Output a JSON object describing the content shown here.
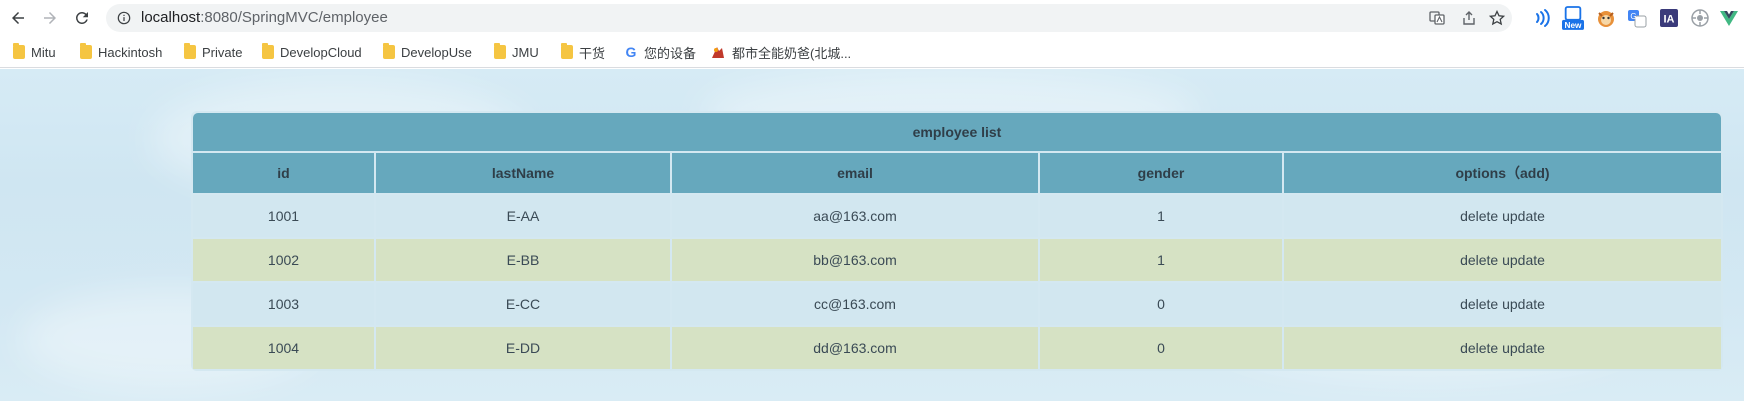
{
  "browser": {
    "url_host": "localhost",
    "url_rest": ":8080/SpringMVC/employee",
    "extensions": [
      "signal-icon",
      "new-badge-icon",
      "fox-icon",
      "translate-icon",
      "ia-icon",
      "gear-flower-icon",
      "vue-icon"
    ],
    "new_badge": "New",
    "ia_label": "IA"
  },
  "bookmarks": [
    {
      "label": "Mitu",
      "icon": "folder-icon"
    },
    {
      "label": "Hackintosh",
      "icon": "folder-icon"
    },
    {
      "label": "Private",
      "icon": "folder-icon"
    },
    {
      "label": "DevelopCloud",
      "icon": "folder-icon"
    },
    {
      "label": "DevelopUse",
      "icon": "folder-icon"
    },
    {
      "label": "JMU",
      "icon": "folder-icon"
    },
    {
      "label": "干货",
      "icon": "folder-icon"
    },
    {
      "label": "您的设备",
      "icon": "google-icon"
    },
    {
      "label": "都市全能奶爸(北城...",
      "icon": "site-icon"
    }
  ],
  "table": {
    "caption": "employee list",
    "headers": [
      "id",
      "lastName",
      "email",
      "gender",
      "options（add)"
    ],
    "rows": [
      {
        "id": "1001",
        "lastName": "E-AA",
        "email": "aa@163.com",
        "gender": "1",
        "delete": "delete",
        "update": "update"
      },
      {
        "id": "1002",
        "lastName": "E-BB",
        "email": "bb@163.com",
        "gender": "1",
        "delete": "delete",
        "update": "update"
      },
      {
        "id": "1003",
        "lastName": "E-CC",
        "email": "cc@163.com",
        "gender": "0",
        "delete": "delete",
        "update": "update"
      },
      {
        "id": "1004",
        "lastName": "E-DD",
        "email": "dd@163.com",
        "gender": "0",
        "delete": "delete",
        "update": "update"
      }
    ]
  },
  "colors": {
    "header_bg": "#66a8bd",
    "row_odd": "#d2e7f0",
    "row_even": "#d6e2c4",
    "page_bg": "#d6ebf5"
  }
}
